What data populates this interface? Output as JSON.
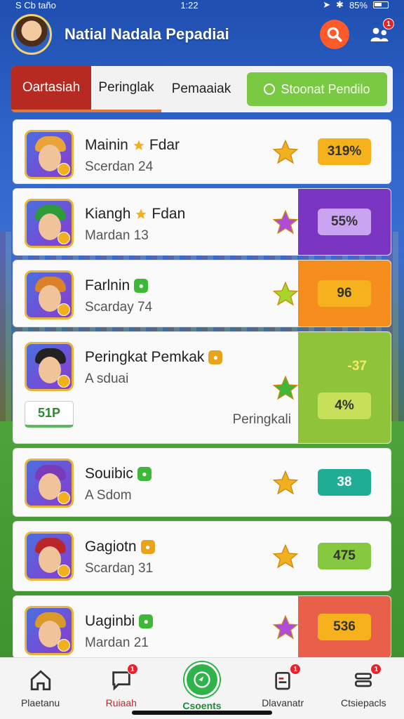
{
  "status_bar": {
    "carrier": "S Cb taño",
    "time": "1:22",
    "battery": "85%"
  },
  "header": {
    "title": "Natial Nadala Pepadiai",
    "friends_badge": "1"
  },
  "tabs": [
    {
      "label": "Oartasiah"
    },
    {
      "label": "Peringlak"
    },
    {
      "label": "Pemaaiak"
    },
    {
      "label": "Stoonat Pendilo"
    }
  ],
  "rows": [
    {
      "name": "Mainin",
      "name_suffix": "Fdar",
      "sub": "Scerdan 24",
      "score": "319%",
      "panel_color": "#ffffff",
      "pill_color": "#f5b21c",
      "star_color": "#f2b01e",
      "hair": "#e8a43a"
    },
    {
      "name": "Kiangh",
      "name_suffix": "Fdan",
      "sub": "Mardan 13",
      "score": "55%",
      "panel_color": "#7a35c2",
      "pill_color": "#c9a4f0",
      "star_color": "#b04cd9",
      "hair": "#2e9a3a"
    },
    {
      "name": "Farlnin",
      "name_suffix": "",
      "sub": "Scarday 74",
      "score": "96",
      "panel_color": "#f58d1c",
      "pill_color": "#f5b21c",
      "star_color": "#a6d62a",
      "hair": "#d9822a"
    },
    {
      "name": "Peringkat Pemkak",
      "name_suffix": "",
      "sub": "A sduai",
      "score": "4%",
      "score_top": "-37",
      "extra_chip": "51P",
      "extra_label": "Peringkali",
      "panel_color": "#8fc43a",
      "pill_color": "#c7e05a",
      "star_color": "#3fb83a",
      "hair": "#222222"
    },
    {
      "name": "Souibic",
      "name_suffix": "",
      "sub": "A Sdom",
      "score": "38",
      "panel_color": "#ffffff",
      "pill_color": "#1fae95",
      "star_color": "#f2b01e",
      "hair": "#7a3bb8"
    },
    {
      "name": "Gagiotn",
      "name_suffix": "",
      "sub": "Scardaŋ 31",
      "score": "475",
      "panel_color": "#ffffff",
      "pill_color": "#86c840",
      "star_color": "#f2b01e",
      "hair": "#b8262a"
    },
    {
      "name": "Uaginbi",
      "name_suffix": "",
      "sub": "Mardan 21",
      "score": "536",
      "panel_color": "#e8604a",
      "pill_color": "#f5b21c",
      "star_color": "#b04cd9",
      "hair": "#d99a2a"
    }
  ],
  "bottom_nav": [
    {
      "label": "Plaetanu"
    },
    {
      "label": "Ruiaah",
      "badge": "1"
    },
    {
      "label": "Csoents"
    },
    {
      "label": "Dlavanatr",
      "badge": "1"
    },
    {
      "label": "Ctsiepacls",
      "badge": "1"
    }
  ]
}
